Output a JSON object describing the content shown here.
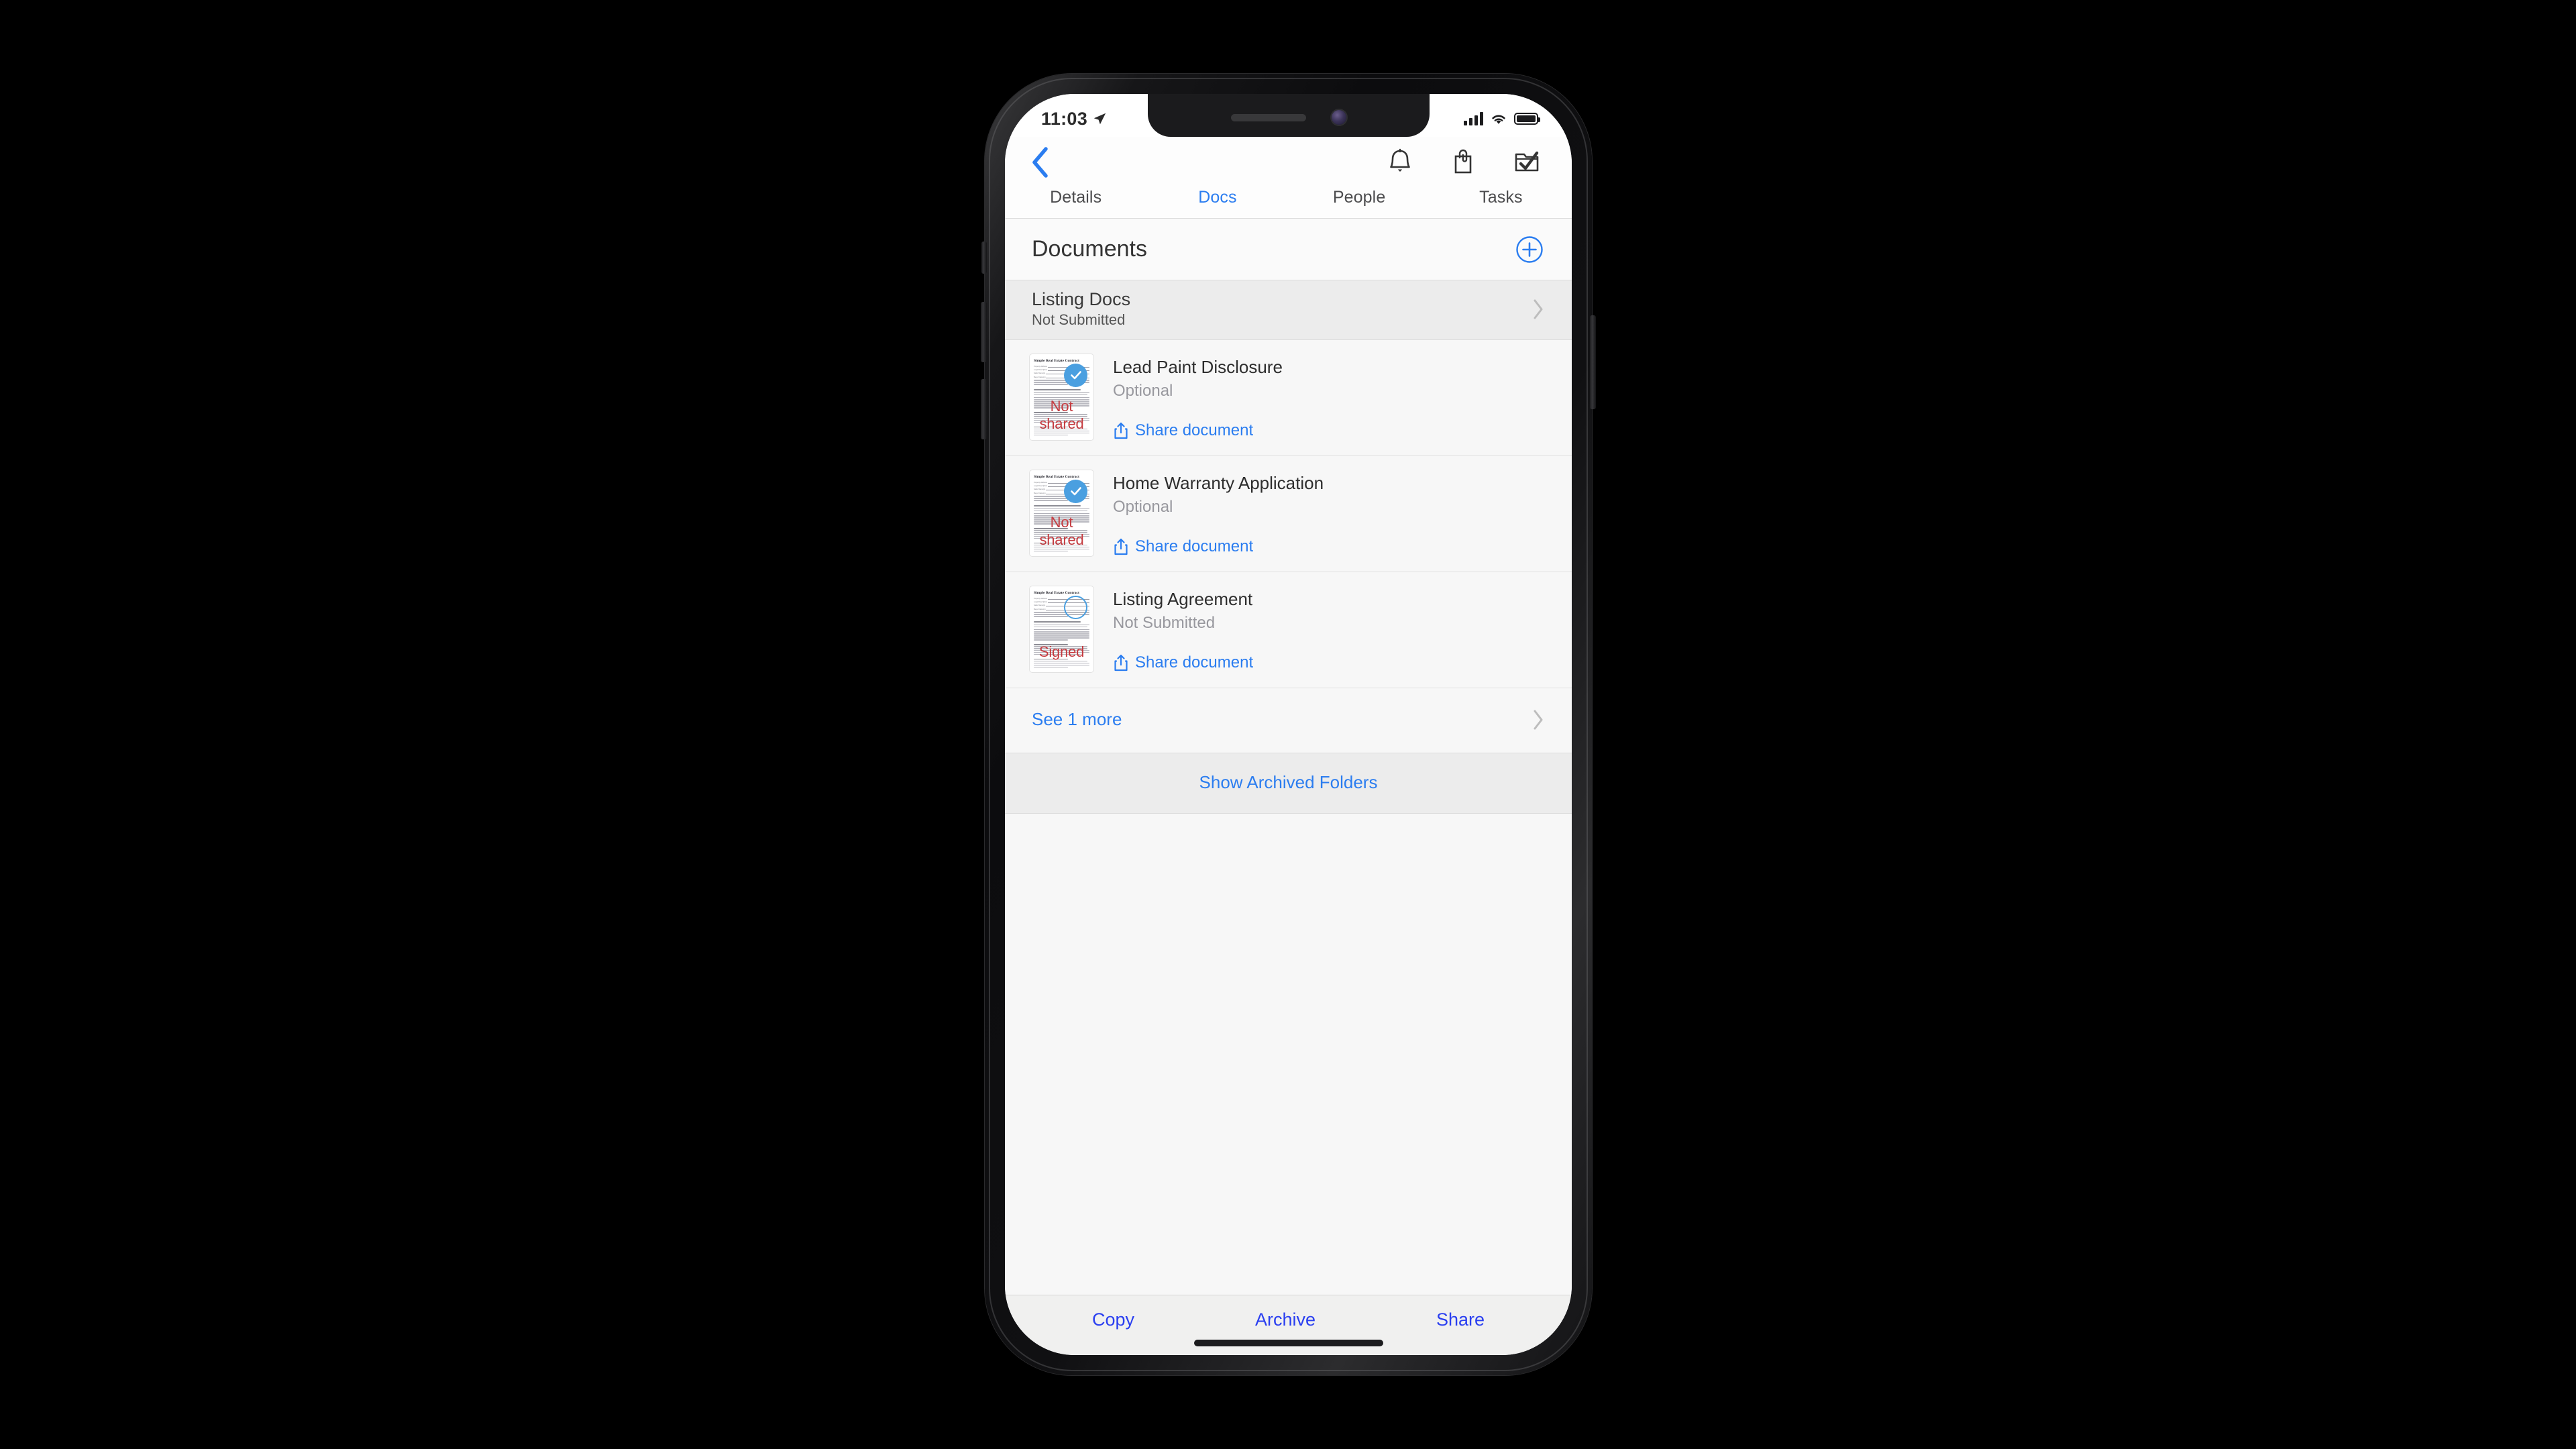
{
  "status_bar": {
    "time": "11:03",
    "location_icon": "location-arrow-icon",
    "cellular_icon": "cellular-signal-icon",
    "wifi_icon": "wifi-icon",
    "battery_icon": "battery-full-icon"
  },
  "nav_bar": {
    "back_icon": "chevron-left-icon",
    "actions": [
      {
        "name": "notifications-icon",
        "label": "Notifications"
      },
      {
        "name": "attachments-bag-icon",
        "label": "Attachments"
      },
      {
        "name": "tasks-folder-check-icon",
        "label": "Tasks"
      }
    ]
  },
  "tabs": [
    {
      "label": "Details",
      "active": false
    },
    {
      "label": "Docs",
      "active": true
    },
    {
      "label": "People",
      "active": false
    },
    {
      "label": "Tasks",
      "active": false
    }
  ],
  "section": {
    "title": "Documents",
    "add_button_label": "+"
  },
  "folder": {
    "name": "Listing Docs",
    "status": "Not Submitted",
    "chevron": "chevron-right-icon"
  },
  "documents": [
    {
      "name": "Lead Paint Disclosure",
      "status": "Optional",
      "share_label": "Share document",
      "badge": "checked",
      "watermark": "Not shared",
      "thumb_title": "Simple Real Estate Contract"
    },
    {
      "name": "Home Warranty Application",
      "status": "Optional",
      "share_label": "Share document",
      "badge": "checked",
      "watermark": "Not shared",
      "thumb_title": "Simple Real Estate Contract"
    },
    {
      "name": "Listing Agreement",
      "status": "Not Submitted",
      "share_label": "Share document",
      "badge": "empty",
      "watermark": "Signed",
      "thumb_title": "Simple Real Estate Contract"
    }
  ],
  "thumb_fields": [
    "Property Address",
    "Legal Description",
    "Seller Name(s)",
    "Buyer Name(s)"
  ],
  "see_more": {
    "label": "See 1 more",
    "chevron": "chevron-right-icon"
  },
  "archived": {
    "label": "Show Archived Folders"
  },
  "bottom_bar": [
    {
      "label": "Copy"
    },
    {
      "label": "Archive"
    },
    {
      "label": "Share"
    }
  ],
  "colors": {
    "accent_blue": "#2b7df0",
    "badge_blue": "#4a9fe0",
    "watermark_red": "#c43a3f",
    "toolbar_blue": "#2a3ff0",
    "text_primary": "#2e2e2e",
    "text_secondary": "#98989e"
  }
}
